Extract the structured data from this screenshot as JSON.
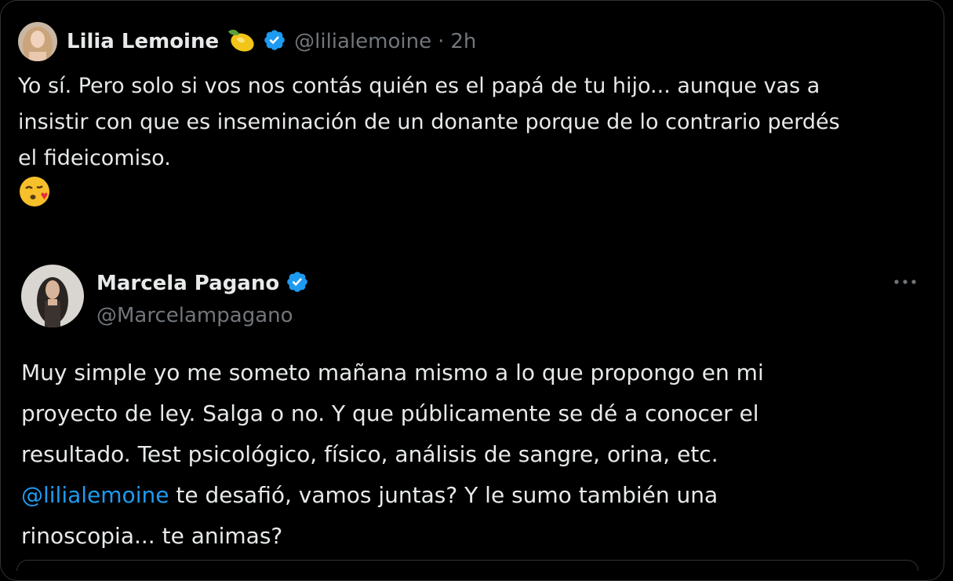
{
  "reply": {
    "author_name": "Lilia Lemoine",
    "author_handle": "@lilialemoine",
    "separator": "·",
    "time": "2h",
    "name_emoji_icon": "lemon-icon",
    "line1": "Yo sí. Pero solo si vos nos contás quién es el papá de tu hijo... aunque vas a",
    "line2": "insistir con que es inseminación de un donante porque de lo contrario perdés",
    "line3": "el fideicomiso.",
    "trailing_emoji_icon": "face-blowing-kiss-icon"
  },
  "quoted": {
    "author_name": "Marcela Pagano",
    "author_handle": "@Marcelampagano",
    "more_icon": "more-dots-icon",
    "text_line1": "Muy simple yo me someto mañana mismo a lo que propongo en mi",
    "text_line2": "proyecto de ley. Salga o no. Y que públicamente se dé a conocer el",
    "text_line3": "resultado. Test psicológico, físico, análisis de sangre, orina, etc.",
    "mention": "@lilialemoine",
    "text_line4_rest": " te desafió, vamos juntas? Y le sumo también una",
    "text_line5": "rinoscopia... te animas?"
  },
  "colors": {
    "background": "#000000",
    "text": "#e7e9ea",
    "muted": "#71767b",
    "link": "#1d9bf0",
    "verified": "#1d9bf0",
    "border": "#2f3336"
  }
}
